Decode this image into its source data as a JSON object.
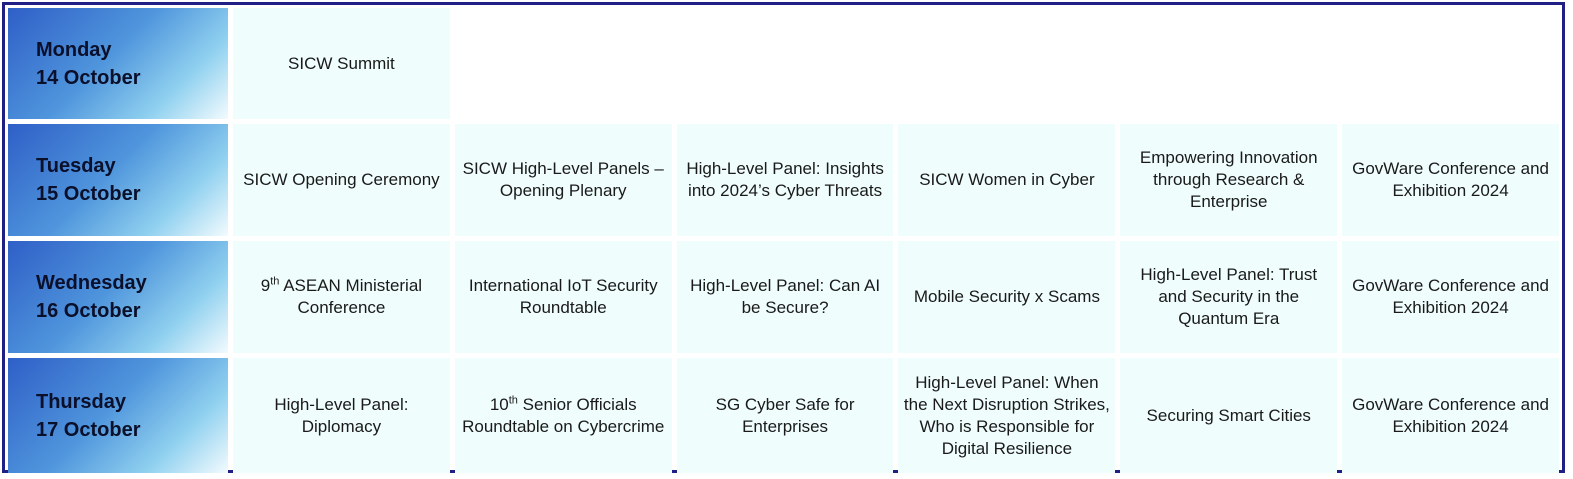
{
  "days": [
    {
      "name": "Monday",
      "date": "14 October"
    },
    {
      "name": "Tuesday",
      "date": "15 October"
    },
    {
      "name": "Wednesday",
      "date": "16 October"
    },
    {
      "name": "Thursday",
      "date": "17 October"
    }
  ],
  "monday": {
    "events": [
      "SICW Summit"
    ]
  },
  "tuesday": {
    "events": [
      "SICW Opening Ceremony",
      "SICW High-Level Panels – Opening Plenary",
      "High-Level Panel: Insights into 2024’s Cyber Threats",
      "SICW Women in Cyber",
      "Empowering Innovation through Research & Enterprise",
      "GovWare Conference and Exhibition 2024"
    ]
  },
  "wednesday": {
    "ordinal_num": "9",
    "ordinal_suffix": "th",
    "asean_rest": " ASEAN Ministerial Conference",
    "events": [
      "International IoT Security Roundtable",
      "High-Level Panel: Can AI be Secure?",
      "Mobile Security x Scams",
      "High-Level Panel: Trust and Security in the Quantum Era",
      "GovWare Conference and Exhibition 2024"
    ]
  },
  "thursday": {
    "first": "High-Level Panel: Diplomacy",
    "ordinal_num": "10",
    "ordinal_suffix": "th",
    "sorc_rest": " Senior Officials Roundtable on Cybercrime",
    "events": [
      "SG Cyber Safe for Enterprises",
      "High-Level Panel: When the Next Disruption Strikes, Who is Responsible for Digital Resilience",
      "Securing Smart Cities",
      "GovWare Conference and Exhibition 2024"
    ]
  }
}
